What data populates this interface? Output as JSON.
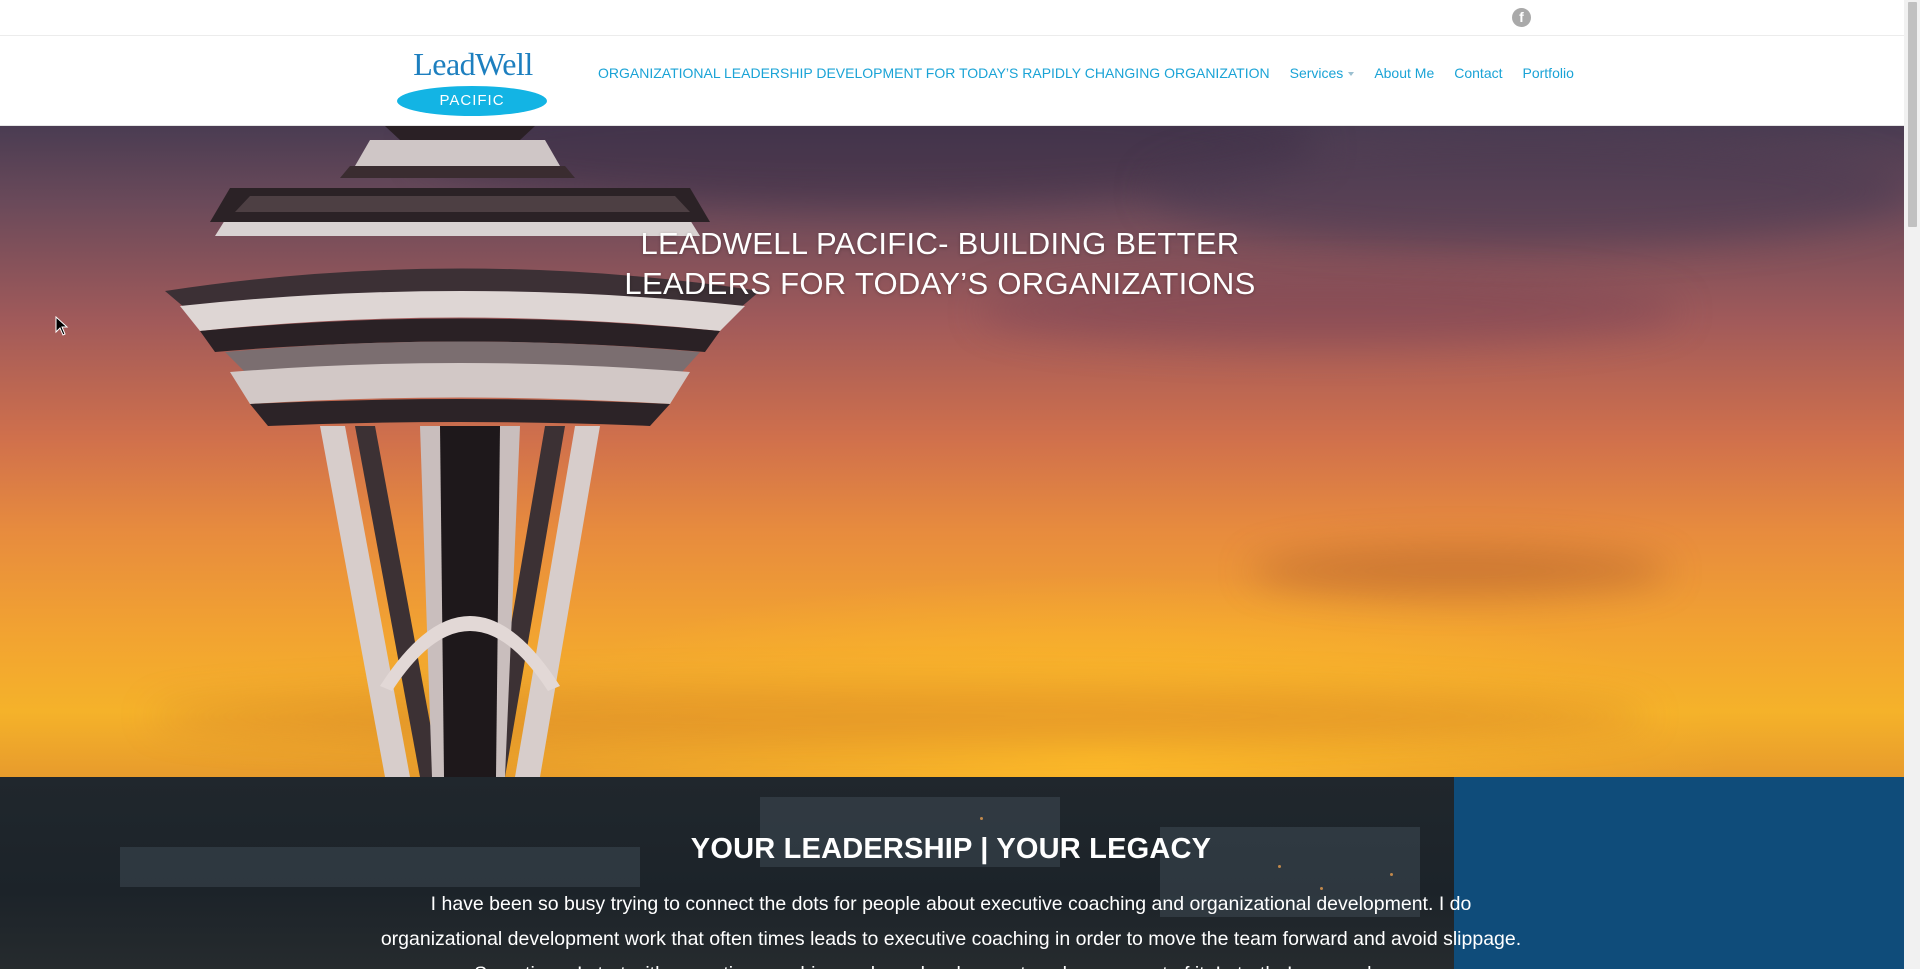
{
  "topbar": {
    "social": [
      {
        "icon": "facebook-icon",
        "glyph": "f"
      }
    ]
  },
  "logo": {
    "title": "LeadWell",
    "subtitle": "PACIFIC"
  },
  "nav": {
    "items": [
      {
        "label": "ORGANIZATIONAL LEADERSHIP DEVELOPMENT FOR TODAY’S RAPIDLY CHANGING ORGANIZATION"
      },
      {
        "label": "Services",
        "has_dropdown": true
      },
      {
        "label": "About Me"
      },
      {
        "label": "Contact"
      },
      {
        "label": "Portfolio"
      }
    ]
  },
  "hero": {
    "title_line1": "LEADWELL PACIFIC- BUILDING BETTER",
    "title_line2": "LEADERS FOR TODAY’S ORGANIZATIONS"
  },
  "band": {
    "title": "YOUR LEADERSHIP | YOUR LEGACY",
    "text": "I have been so busy trying to connect the dots for people about executive coaching and organizational development. I do organizational development work that often times leads to executive coaching in order to move the team forward and avoid slippage. Sometimes I start with executive coaching and org development work comes out of it. In truth, I am much more"
  },
  "colors": {
    "nav_link": "#1aa3d6",
    "logo_oval": "#13b4e4",
    "band_right": "#0f4c7a"
  }
}
